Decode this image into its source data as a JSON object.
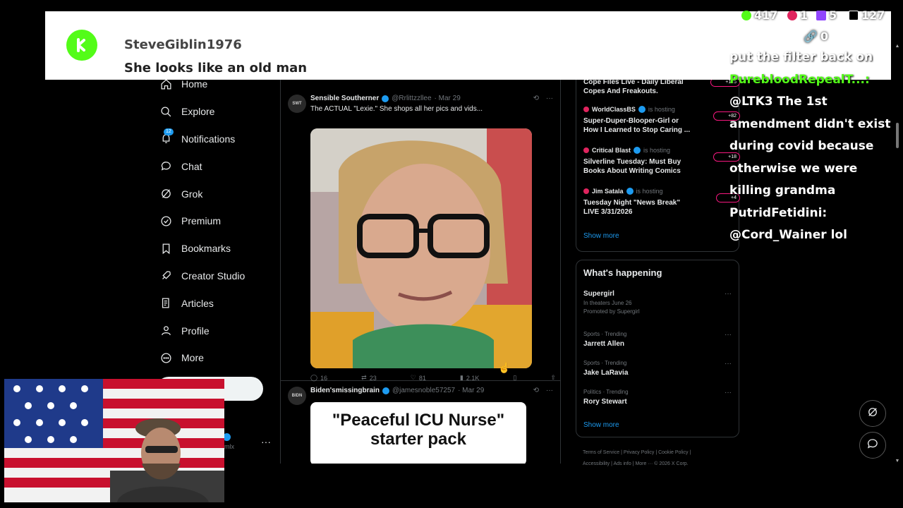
{
  "sidebar": {
    "items": [
      {
        "label": "Home",
        "icon": "home-icon"
      },
      {
        "label": "Explore",
        "icon": "search-icon"
      },
      {
        "label": "Notifications",
        "icon": "bell-icon",
        "badge": "12"
      },
      {
        "label": "Chat",
        "icon": "chat-icon"
      },
      {
        "label": "Grok",
        "icon": "grok-icon"
      },
      {
        "label": "Premium",
        "icon": "premium-icon"
      },
      {
        "label": "Bookmarks",
        "icon": "bookmark-icon"
      },
      {
        "label": "Creator Studio",
        "icon": "rocket-icon"
      },
      {
        "label": "Articles",
        "icon": "article-icon"
      },
      {
        "label": "Profile",
        "icon": "person-icon"
      },
      {
        "label": "More",
        "icon": "more-circle-icon"
      }
    ],
    "account_handle_fragment": "mlx",
    "more_dots": "···"
  },
  "feed": {
    "tweet1": {
      "name": "Sensible Southerner",
      "handle": "@Rrlittzzllee",
      "date": "· Mar 29",
      "text": "The ACTUAL \"Lexie.\"  She shops all her pics and vids...",
      "replies": "16",
      "reposts": "23",
      "likes": "81",
      "views": "2.1K"
    },
    "tweet2": {
      "name": "Biden'smissingbrain",
      "handle": "@jamesnoble57257",
      "date": "· Mar 29",
      "card_text": "\"Peaceful ICU Nurse\" starter pack"
    }
  },
  "spaces": [
    {
      "title": "Cope Files Live - Daily Liberal Copes And Freakouts.",
      "count": "+125"
    },
    {
      "host": "WorldClassBS",
      "status": "is hosting",
      "title": "Super-Duper-Blooper-Girl or How I Learned to Stop Caring ...",
      "count": "+82"
    },
    {
      "host": "Critical Blast",
      "status": "is hosting",
      "title": "Silverline Tuesday: Must Buy Books About Writing Comics",
      "count": "+18"
    },
    {
      "host": "Jim Satala",
      "status": "is hosting",
      "title": "Tuesday Night \"News Break\" LIVE 3/31/2026",
      "count": "+4"
    }
  ],
  "spaces_show_more": "Show more",
  "happening": {
    "title": "What's happening",
    "trends": [
      {
        "name": "Supergirl",
        "sub1": "In theaters June 26",
        "sub2": "Promoted by Supergirl"
      },
      {
        "meta": "Sports · Trending",
        "name": "Jarrett Allen"
      },
      {
        "meta": "Sports · Trending",
        "name": "Jake LaRavia"
      },
      {
        "meta": "Politics · Trending",
        "name": "Rory Stewart"
      }
    ],
    "show_more": "Show more"
  },
  "footer": {
    "line1": "Terms of Service  |  Privacy Policy  |  Cookie Policy  |",
    "line2": "Accessibility  |  Ads info  |  More ···  © 2026 X Corp."
  },
  "alert": {
    "username": "SteveGiblin1976",
    "message": "She looks like an old man"
  },
  "viewer_counts": {
    "kick": "417",
    "rumble": "1",
    "twitch": "5",
    "x": "127",
    "link": "0"
  },
  "chat": {
    "line1_text": "put the filter back on",
    "line2_user": "PurebloodRepealT...:",
    "line3_text": "@LTK3 The 1st amendment didn't exist during covid because otherwise we were killing grandma",
    "line4_user": "PutridFetidini:",
    "line5_text": "@Cord_Wainer lol"
  },
  "colors": {
    "kick_green": "#53fc18",
    "x_blue": "#1d9bf0",
    "live_pink": "#f91880"
  }
}
